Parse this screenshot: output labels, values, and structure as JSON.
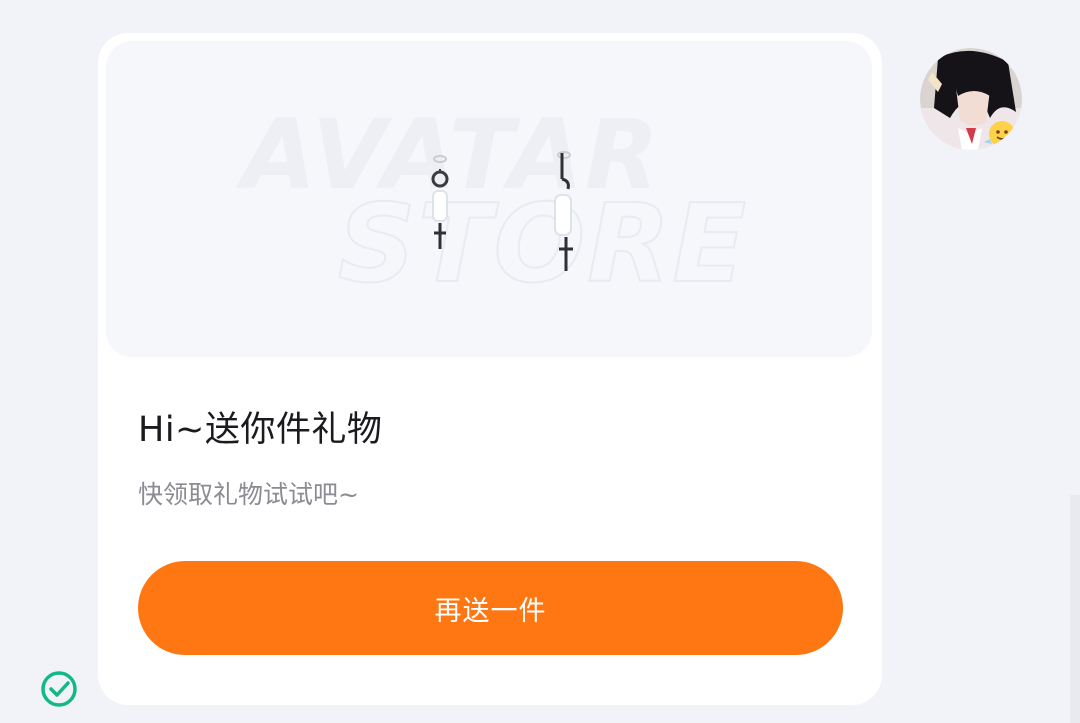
{
  "colors": {
    "page_background": "#f2f3f8",
    "card_background": "#ffffff",
    "banner_background": "#f6f7fb",
    "accent": "#ff7712",
    "success": "#12b886"
  },
  "gift_card": {
    "banner": {
      "watermark_line1": "AVATAR",
      "watermark_line2": "STORE",
      "product_icon": "earrings-icon"
    },
    "title": "Hi~送你件礼物",
    "subtitle": "快领取礼物试试吧~",
    "cta_label": "再送一件"
  },
  "avatar_icon": "user-avatar",
  "status_icon": "check-circle-icon"
}
